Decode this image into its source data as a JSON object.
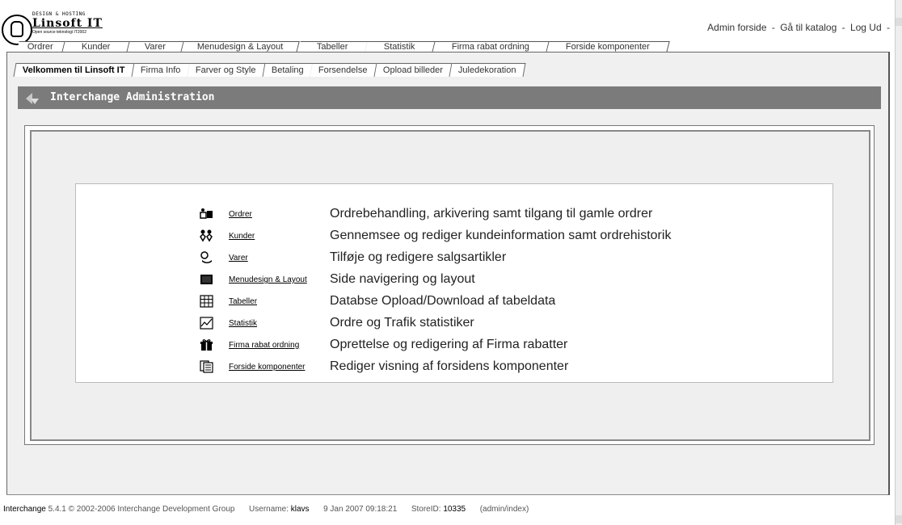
{
  "logo": {
    "line1": "DESIGN & HOSTING",
    "line2": "Linsoft IT",
    "line3": "Open source teknologi IT2002"
  },
  "top_links": [
    "Admin forside",
    "Gå til katalog",
    "Log Ud"
  ],
  "top_links_sep": "-",
  "main_tabs": [
    "Ordrer",
    "Kunder",
    "Varer",
    "Menudesign & Layout",
    "Tabeller",
    "Statistik",
    "Firma rabat ordning",
    "Forside komponenter"
  ],
  "sub_tabs": [
    "Velkommen til Linsoft IT",
    "Firma Info",
    "Farver og Style",
    "Betaling",
    "Forsendelse",
    "Opload billeder",
    "Juledekoration"
  ],
  "title": "Interchange Administration",
  "menu": [
    {
      "icon": "orders-icon",
      "link": "Ordrer",
      "desc": "Ordrebehandling, arkivering samt tilgang til gamle ordrer"
    },
    {
      "icon": "customers-icon",
      "link": "Kunder",
      "desc": "Gennemsee og rediger kundeinformation samt ordrehistorik"
    },
    {
      "icon": "products-icon",
      "link": "Varer",
      "desc": "Tilføje og redigere salgsartikler"
    },
    {
      "icon": "layout-icon",
      "link": "Menudesign & Layout",
      "desc": "Side navigering og layout"
    },
    {
      "icon": "table-icon",
      "link": "Tabeller",
      "desc": "Databse Opload/Download af tabeldata"
    },
    {
      "icon": "statistics-icon",
      "link": "Statistik",
      "desc": "Ordre og Trafik statistiker"
    },
    {
      "icon": "gift-icon",
      "link": "Firma rabat ordning",
      "desc": "Oprettelse og redigering af Firma rabatter"
    },
    {
      "icon": "components-icon",
      "link": "Forside komponenter",
      "desc": "Rediger visning af forsidens komponenter"
    }
  ],
  "footer": {
    "product": "Interchange",
    "version": "5.4.1 © 2002-2006 Interchange Development Group",
    "username_label": "Username:",
    "username": "klavs",
    "datetime": "9 Jan 2007 09:18:21",
    "store_label": "StoreID:",
    "store_id": "10335",
    "path": "(admin/index)"
  },
  "colors": {
    "title_bar": "#7b7b7b",
    "panel_bg": "#efefef"
  }
}
